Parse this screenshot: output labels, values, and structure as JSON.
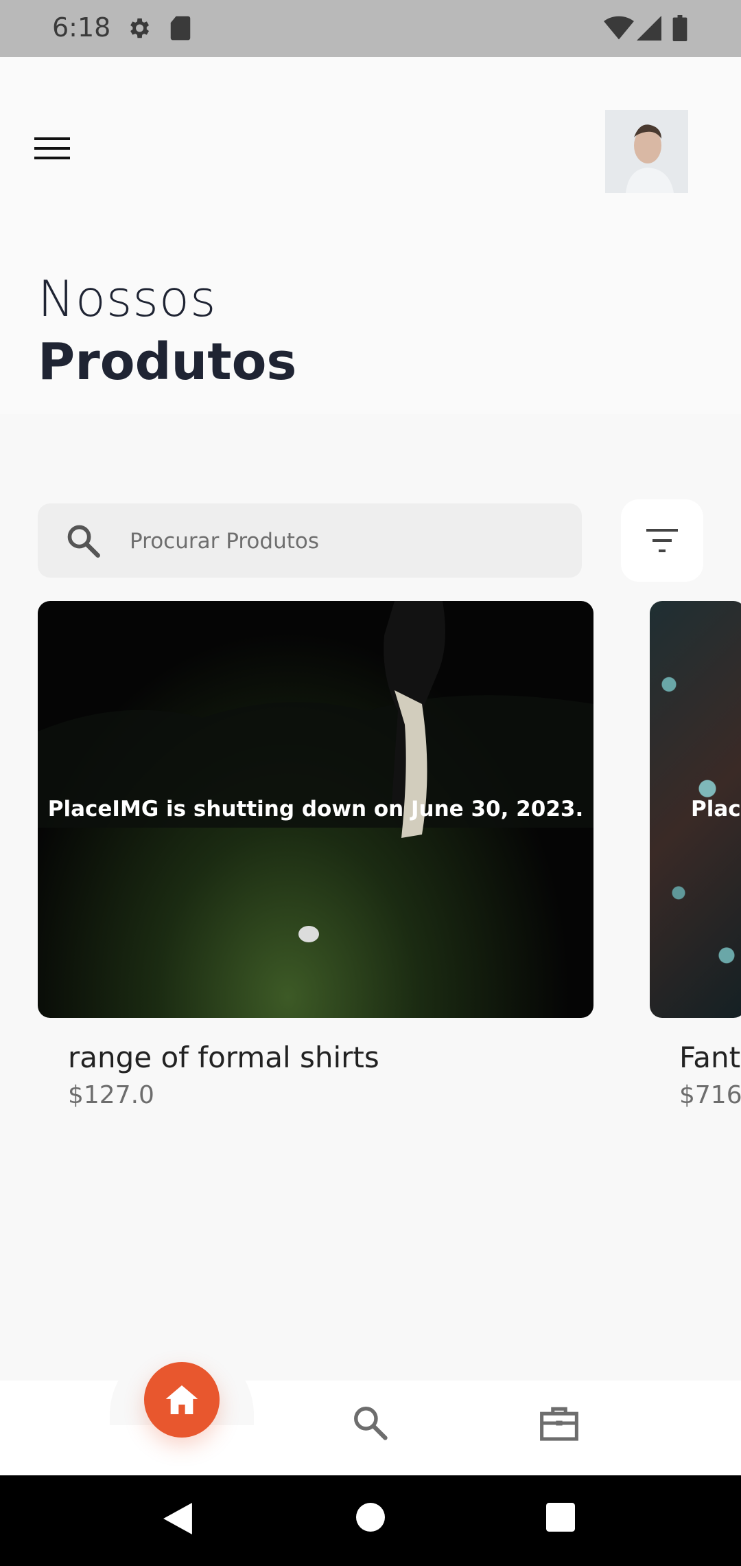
{
  "status_bar": {
    "time": "6:18",
    "icons": [
      "gear-icon",
      "sd-card-icon",
      "wifi-icon",
      "signal-icon",
      "battery-icon"
    ]
  },
  "header": {
    "menu_icon": "hamburger-menu-icon",
    "avatar": "profile-avatar"
  },
  "title": {
    "line1": "Nossos",
    "line2": "Produtos"
  },
  "search": {
    "placeholder": "Procurar Produtos",
    "icon": "search-icon",
    "filter_icon": "filter-icon"
  },
  "products": [
    {
      "image_text": "PlaceIMG is shutting down on June 30, 2023.",
      "name": "range of formal shirts",
      "price": "$127.0"
    },
    {
      "image_text": "Plac",
      "name": "Fant",
      "price": "$716"
    }
  ],
  "bottom_nav": {
    "items": [
      "home-icon",
      "search-icon",
      "briefcase-icon"
    ],
    "active": "home",
    "accent_color": "#e8572e"
  },
  "system_nav": [
    "back-icon",
    "home-circle-icon",
    "recents-square-icon"
  ]
}
